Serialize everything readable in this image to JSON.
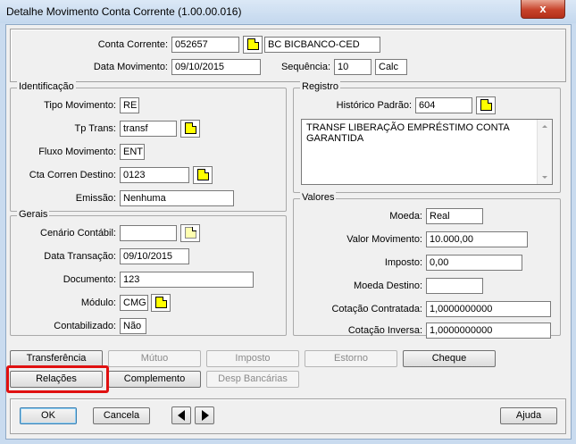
{
  "window": {
    "title": "Detalhe Movimento Conta Corrente (1.00.00.016)",
    "close_label": "x"
  },
  "header": {
    "conta_corrente_label": "Conta Corrente:",
    "conta_corrente_value": "052657",
    "conta_corrente_desc": "BC BICBANCO-CED",
    "data_movimento_label": "Data Movimento:",
    "data_movimento_value": "09/10/2015",
    "sequencia_label": "Sequência:",
    "sequencia_value": "10",
    "calc_value": "Calc"
  },
  "identificacao": {
    "legend": "Identificação",
    "tipo_movimento_label": "Tipo Movimento:",
    "tipo_movimento_value": "RE",
    "tp_trans_label": "Tp Trans:",
    "tp_trans_value": "transf",
    "fluxo_label": "Fluxo Movimento:",
    "fluxo_value": "ENT",
    "cta_destino_label": "Cta Corren Destino:",
    "cta_destino_value": "0123",
    "emissao_label": "Emissão:",
    "emissao_value": "Nenhuma"
  },
  "gerais": {
    "legend": "Gerais",
    "cenario_label": "Cenário Contábil:",
    "cenario_value": "",
    "data_transacao_label": "Data Transação:",
    "data_transacao_value": "09/10/2015",
    "documento_label": "Documento:",
    "documento_value": "123",
    "modulo_label": "Módulo:",
    "modulo_value": "CMG",
    "contabilizado_label": "Contabilizado:",
    "contabilizado_value": "Não"
  },
  "registro": {
    "legend": "Registro",
    "historico_label": "Histórico Padrão:",
    "historico_value": "604",
    "descricao": "TRANSF LIBERAÇÃO EMPRÉSTIMO CONTA GARANTIDA"
  },
  "valores": {
    "legend": "Valores",
    "moeda_label": "Moeda:",
    "moeda_value": "Real",
    "valor_label": "Valor Movimento:",
    "valor_value": "10.000,00",
    "imposto_label": "Imposto:",
    "imposto_value": "0,00",
    "moeda_destino_label": "Moeda Destino:",
    "moeda_destino_value": "",
    "cot_contratada_label": "Cotação Contratada:",
    "cot_contratada_value": "1,0000000000",
    "cot_inversa_label": "Cotação Inversa:",
    "cot_inversa_value": "1,0000000000"
  },
  "action_buttons": {
    "transferencia": "Transferência",
    "mutuo": "Mútuo",
    "imposto": "Imposto",
    "estorno": "Estorno",
    "cheque": "Cheque",
    "relacoes": "Relações",
    "complemento": "Complemento",
    "desp_bancarias": "Desp Bancárias"
  },
  "footer": {
    "ok": "OK",
    "cancela": "Cancela",
    "ajuda": "Ajuda"
  },
  "colors": {
    "highlight": "#e01010",
    "lookup_icon": "#ffff00",
    "title_bar": "#c4d8ee"
  }
}
